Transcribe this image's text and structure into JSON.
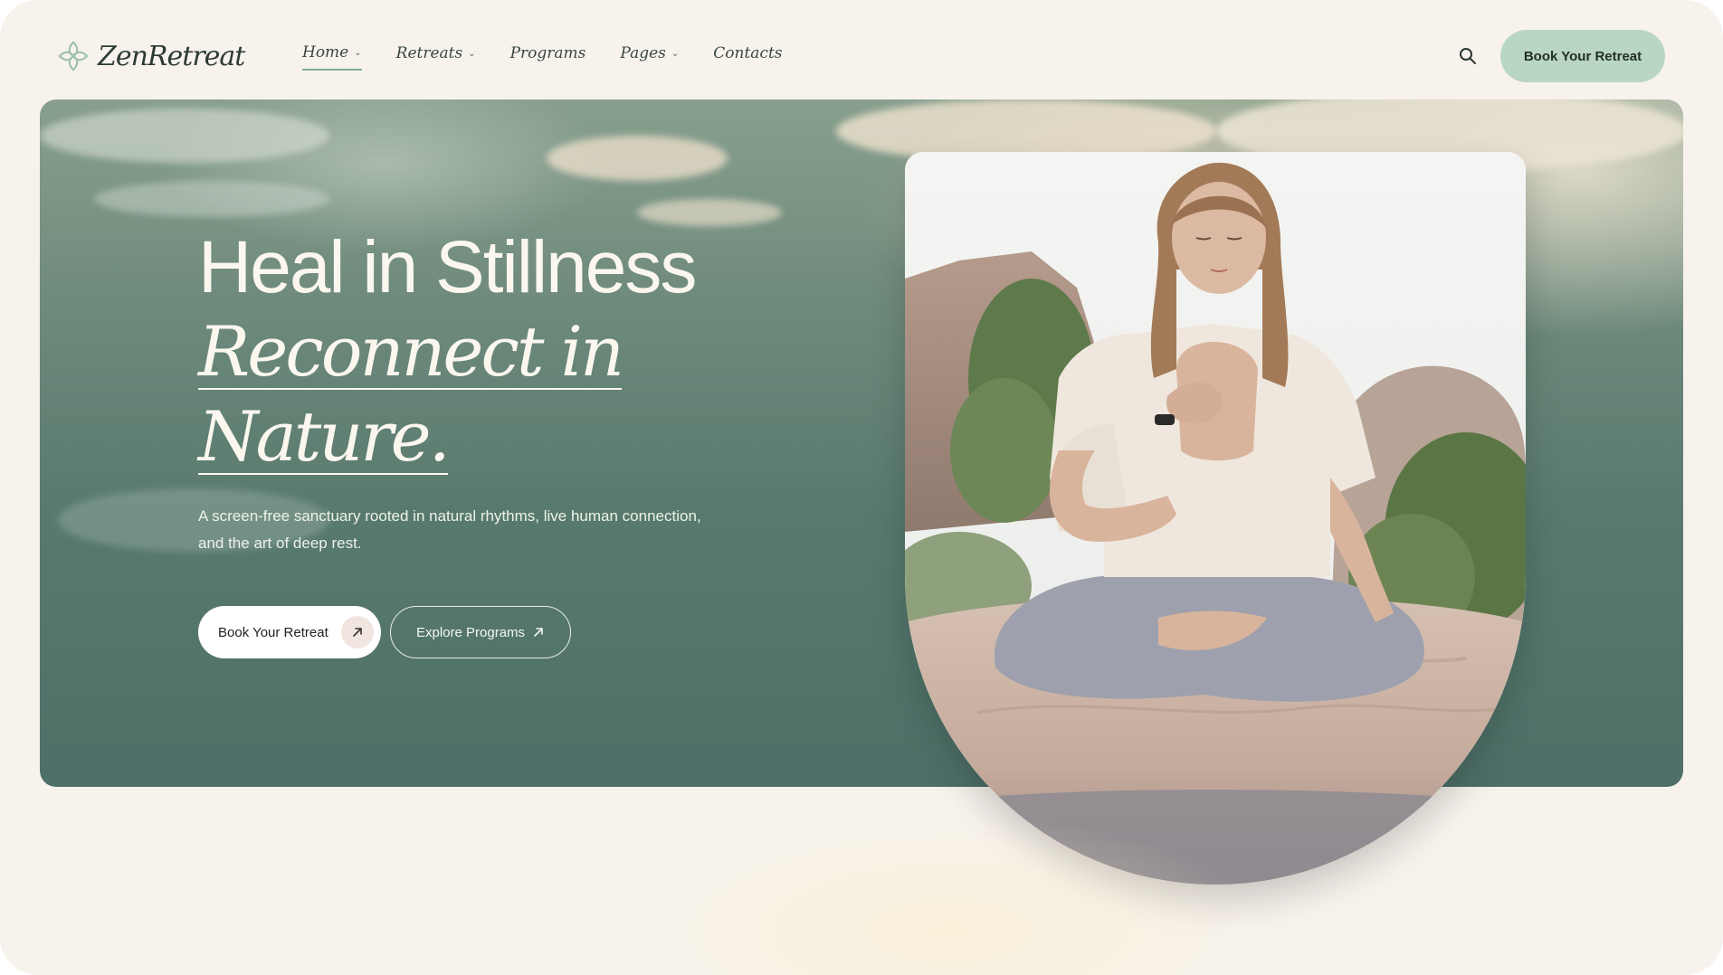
{
  "brand": {
    "name": "ZenRetreat"
  },
  "nav": {
    "items": [
      {
        "label": "Home",
        "has_dropdown": true,
        "active": true
      },
      {
        "label": "Retreats",
        "has_dropdown": true,
        "active": false
      },
      {
        "label": "Programs",
        "has_dropdown": false,
        "active": false
      },
      {
        "label": "Pages",
        "has_dropdown": true,
        "active": false
      },
      {
        "label": "Contacts",
        "has_dropdown": false,
        "active": false
      }
    ],
    "cta_label": "Book Your Retreat",
    "search_icon": "search-icon"
  },
  "hero": {
    "title_line1": "Heal in Stillness",
    "title_line2": "Reconnect in",
    "title_line3": "Nature.",
    "description": "A screen-free sanctuary rooted in natural rhythms, live human connection, and the art of deep rest.",
    "primary_button": "Book Your Retreat",
    "secondary_button": "Explore Programs"
  },
  "colors": {
    "accent_mint": "#b9d6c2",
    "hero_green": "#587a6e",
    "page_bg": "#f7f2ec"
  }
}
